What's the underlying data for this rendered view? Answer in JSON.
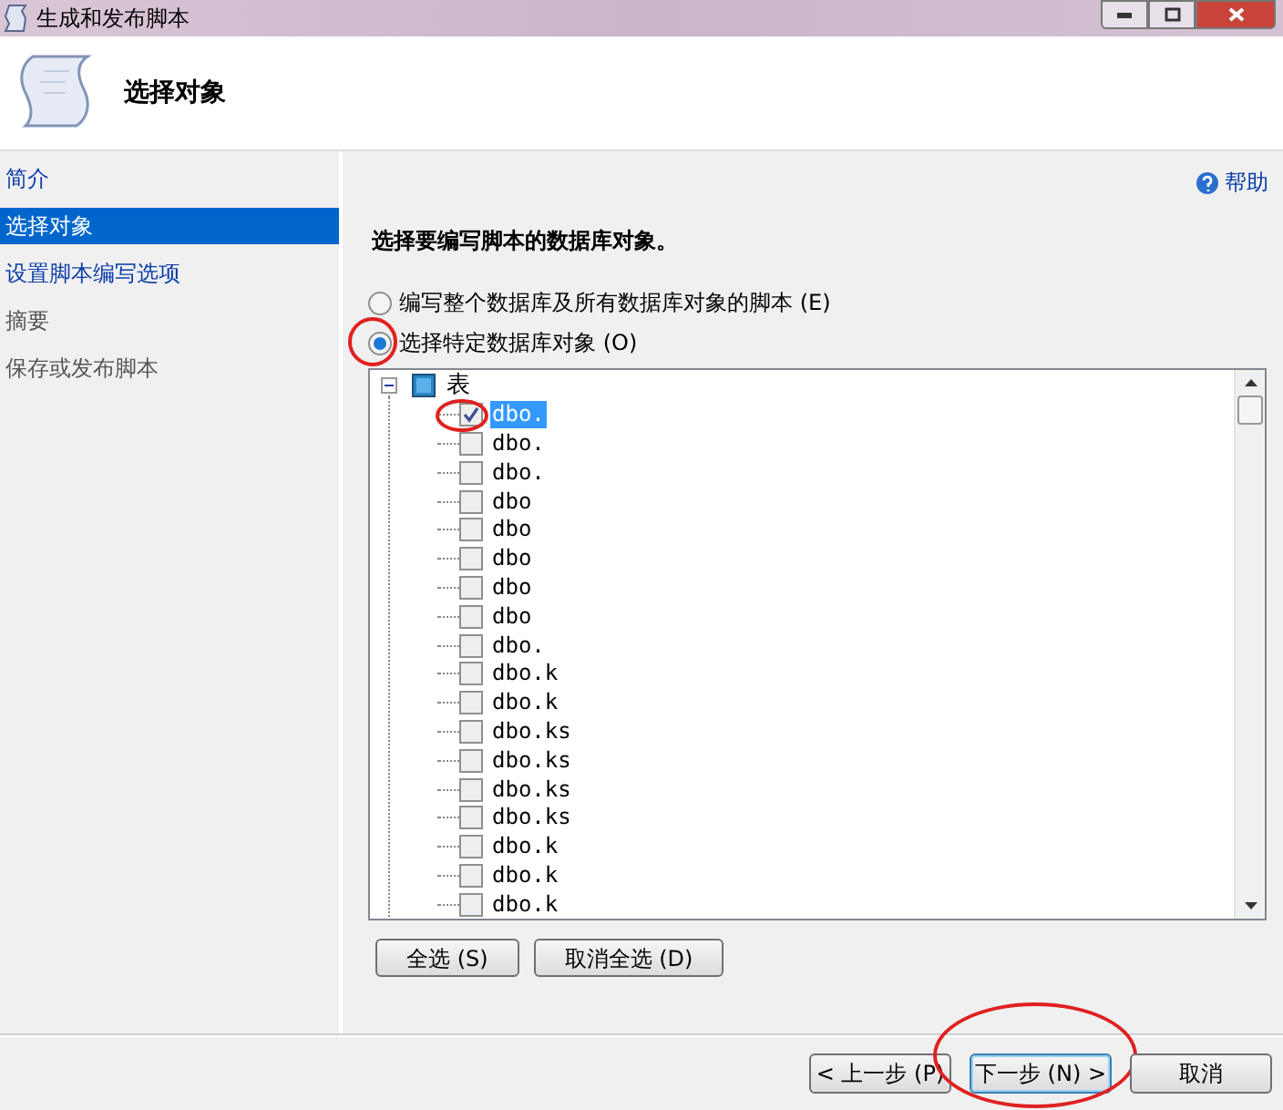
{
  "window": {
    "title": "生成和发布脚本"
  },
  "header": {
    "title": "选择对象"
  },
  "sidebar": {
    "items": [
      {
        "label": "简介",
        "selected": false,
        "enabled": true
      },
      {
        "label": "选择对象",
        "selected": true,
        "enabled": true
      },
      {
        "label": "设置脚本编写选项",
        "selected": false,
        "enabled": true
      },
      {
        "label": "摘要",
        "selected": false,
        "enabled": false
      },
      {
        "label": "保存或发布脚本",
        "selected": false,
        "enabled": false
      }
    ]
  },
  "help": {
    "label": "帮助"
  },
  "prompt": "选择要编写脚本的数据库对象。",
  "options": [
    {
      "label": "编写整个数据库及所有数据库对象的脚本 (E)",
      "selected": false,
      "annotated": false
    },
    {
      "label": "选择特定数据库对象 (O)",
      "selected": true,
      "annotated": true
    }
  ],
  "tree": {
    "label": "表",
    "expanded": true,
    "children": [
      {
        "label": "dbo.",
        "checked": true,
        "selected": true,
        "annotated": true
      },
      {
        "label": "dbo.",
        "checked": false,
        "selected": false,
        "annotated": false
      },
      {
        "label": "dbo.",
        "checked": false,
        "selected": false,
        "annotated": false
      },
      {
        "label": "dbo",
        "checked": false,
        "selected": false,
        "annotated": false
      },
      {
        "label": "dbo",
        "checked": false,
        "selected": false,
        "annotated": false
      },
      {
        "label": "dbo",
        "checked": false,
        "selected": false,
        "annotated": false
      },
      {
        "label": "dbo",
        "checked": false,
        "selected": false,
        "annotated": false
      },
      {
        "label": "dbo",
        "checked": false,
        "selected": false,
        "annotated": false
      },
      {
        "label": "dbo.",
        "checked": false,
        "selected": false,
        "annotated": false
      },
      {
        "label": "dbo.k",
        "checked": false,
        "selected": false,
        "annotated": false
      },
      {
        "label": "dbo.k",
        "checked": false,
        "selected": false,
        "annotated": false
      },
      {
        "label": "dbo.ks",
        "checked": false,
        "selected": false,
        "annotated": false
      },
      {
        "label": "dbo.ks",
        "checked": false,
        "selected": false,
        "annotated": false
      },
      {
        "label": "dbo.ks",
        "checked": false,
        "selected": false,
        "annotated": false
      },
      {
        "label": "dbo.ks",
        "checked": false,
        "selected": false,
        "annotated": false
      },
      {
        "label": "dbo.k",
        "checked": false,
        "selected": false,
        "annotated": false
      },
      {
        "label": "dbo.k",
        "checked": false,
        "selected": false,
        "annotated": false
      },
      {
        "label": "dbo.k",
        "checked": false,
        "selected": false,
        "annotated": false
      }
    ]
  },
  "select_buttons": [
    "全选 (S)",
    "取消全选 (D)"
  ],
  "nav_buttons": [
    {
      "label": "< 上一步 (P)",
      "default": false,
      "annotated": false
    },
    {
      "label": "下一步 (N) >",
      "default": true,
      "annotated": true
    },
    {
      "label": "取消",
      "default": false,
      "annotated": false
    }
  ]
}
